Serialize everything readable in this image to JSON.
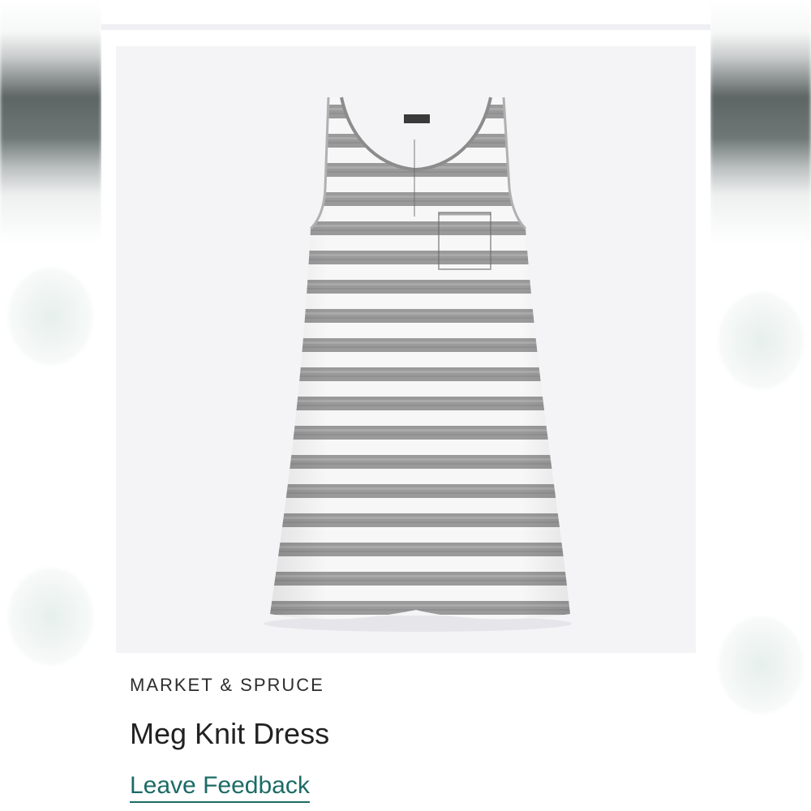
{
  "item": {
    "brand": "MARKET & SPRUCE",
    "name": "Meg Knit Dress",
    "feedback_label": "Leave Feedback",
    "image_subject": "striped-sleeveless-dress"
  },
  "colors": {
    "link": "#1c6b66",
    "photo_background": "#f4f4f7",
    "stripe_gray": "#9a9a9a",
    "stripe_white": "#f7f7f7",
    "divider": "#efeff4"
  }
}
